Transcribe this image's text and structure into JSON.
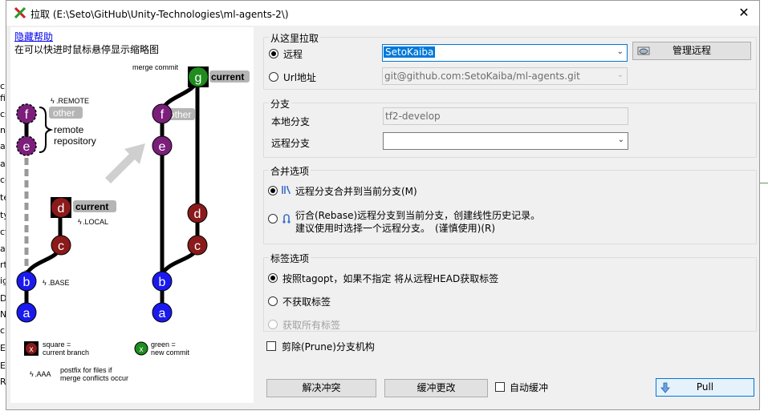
{
  "window": {
    "title": "拉取 (E:\\Seto\\GitHub\\Unity-Technologies\\ml-agents-2\\)",
    "close_glyph": "✕"
  },
  "background_fragments": [
    "cl",
    "fi",
    "cs",
    "n-",
    "a-",
    "ac",
    "ce",
    "te",
    "ty",
    "cy",
    "at",
    "rt",
    "ig",
    "D",
    "N",
    "ck",
    "E",
    "ER",
    "RV"
  ],
  "help": {
    "hide_link": "隐藏帮助",
    "hint": "在可以快进时鼠标悬停显示缩略图",
    "diagram": {
      "merge_commit": "merge commit",
      "remote_tag": ".REMOTE",
      "other": "other",
      "remote_repo_1": "remote",
      "remote_repo_2": "repository",
      "current": "current",
      "local_tag": ".LOCAL",
      "base_tag": ".BASE",
      "other_right": "other",
      "current_right": "current",
      "nodes": {
        "a": "a",
        "b": "b",
        "c": "c",
        "d": "d",
        "e": "e",
        "f": "f",
        "g": "g"
      },
      "legend_square_glyph": "x",
      "legend_square_1": "square =",
      "legend_square_2": "current branch",
      "legend_green_glyph": "x",
      "legend_green_1": "green =",
      "legend_green_2": "new commit",
      "legend_postfix_tag": ".AAA",
      "legend_postfix_1": "postfix for files if",
      "legend_postfix_2": "merge conflicts occur"
    }
  },
  "pull_from": {
    "title": "从这里拉取",
    "remote_label": "远程",
    "remote_value": "SetoKaiba",
    "manage_button": "管理远程",
    "url_label": "Url地址",
    "url_value": "git@github.com:SetoKaiba/ml-agents.git"
  },
  "branch": {
    "title": "分支",
    "local_label": "本地分支",
    "local_value": "tf2-develop",
    "remote_label": "远程分支",
    "remote_value": ""
  },
  "merge_options": {
    "title": "合并选项",
    "merge_label": "远程分支合并到当前分支(M)",
    "rebase_label_1": "衍合(Rebase)远程分支到当前分支，创建线性历史记录。",
    "rebase_label_2": "建议使用时选择一个远程分支。　(谨慎使用)(R)"
  },
  "tag_options": {
    "title": "标签选项",
    "tagopt_label": "按照tagopt，如果不指定 将从远程HEAD获取标签",
    "no_tags_label": "不获取标签",
    "all_tags_label": "获取所有标签"
  },
  "prune_label": "剪除(Prune)分支机构",
  "buttons": {
    "resolve": "解决冲突",
    "stash": "缓冲更改",
    "auto_stash": "自动缓冲",
    "pull": "Pull"
  },
  "colors": {
    "accent": "#0078d7",
    "purple_node": "#7b1f7b",
    "red_node": "#8b1a1a",
    "blue_node": "#1a1aee",
    "green_node": "#1e8c1e"
  }
}
